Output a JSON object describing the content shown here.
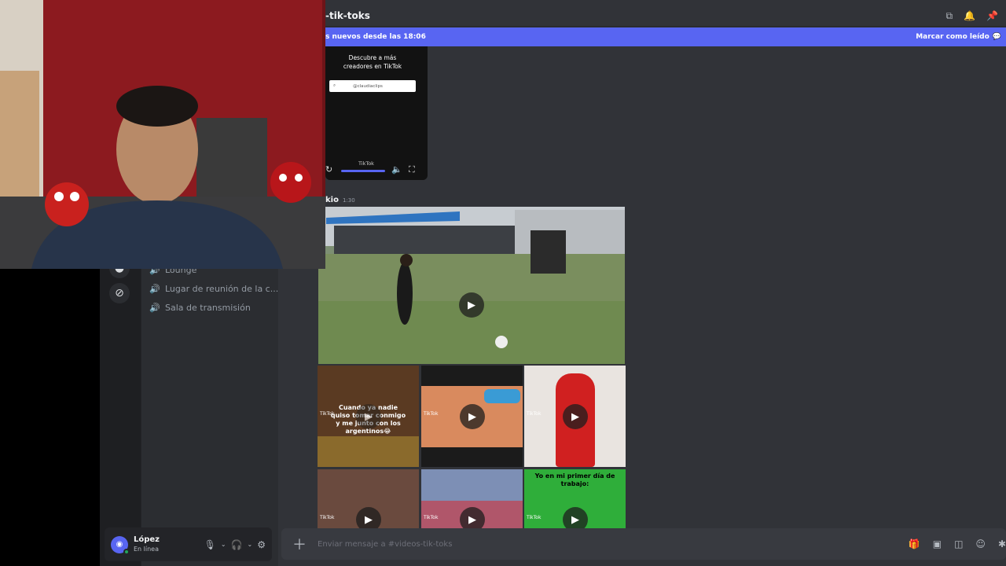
{
  "channel": {
    "title": "-tik-toks",
    "full_name": "#videos-tik-toks"
  },
  "banner": {
    "new_messages": "s nuevos desde las 18:06",
    "mark_read": "Marcar como leído"
  },
  "sidebar": {
    "voice_channels": [
      {
        "label": "Lounge"
      },
      {
        "label": "Lugar de reunión de la c..."
      },
      {
        "label": "Sala de transmisión"
      }
    ]
  },
  "tiktok_embed": {
    "heading_line1": "Descubre a más",
    "heading_line2": "creadores en TikTok",
    "search_value": "@claudiaclips",
    "brand": "TikTok"
  },
  "message": {
    "author": "kio",
    "time": "1:30"
  },
  "thumbnails": [
    {
      "caption": "Cuando ya nadie quiso tomar conmigo y me junto con los argentinos😂",
      "brand": "TikTok"
    },
    {
      "caption": "",
      "brand": "TikTok"
    },
    {
      "caption": "",
      "brand": "TikTok"
    },
    {
      "caption": "",
      "brand": "TikTok"
    },
    {
      "caption": "",
      "brand": "TikTok"
    },
    {
      "caption": "Yo en mi primer día de trabajo:",
      "brand": "TikTok"
    }
  ],
  "composer": {
    "placeholder": "Enviar mensaje a #videos-tik-toks"
  },
  "user": {
    "name": "López",
    "status": "En línea"
  },
  "colors": {
    "accent": "#5865f2",
    "online": "#23a55a",
    "chat_bg": "#313338",
    "sidebar_bg": "#2b2d31"
  }
}
